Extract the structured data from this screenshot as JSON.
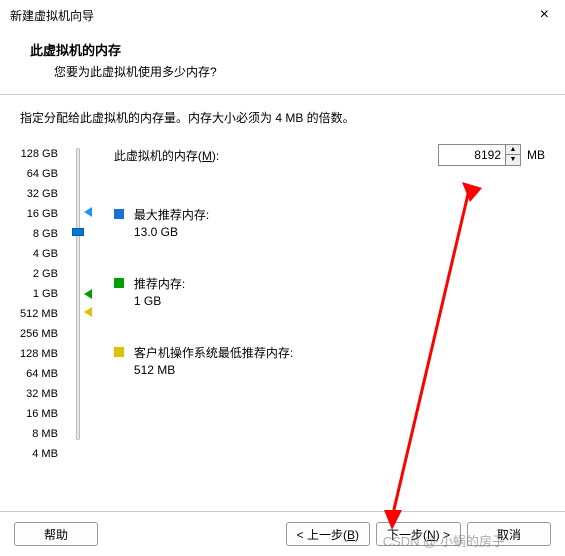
{
  "titlebar": {
    "title": "新建虚拟机向导",
    "close": "×"
  },
  "header": {
    "title": "此虚拟机的内存",
    "subtitle": "您要为此虚拟机使用多少内存?"
  },
  "instruction": "指定分配给此虚拟机的内存量。内存大小必须为 4 MB 的倍数。",
  "memory": {
    "label_pre": "此虚拟机的内存(",
    "label_key": "M",
    "label_post": "):",
    "value": "8192",
    "unit": "MB"
  },
  "scale": [
    "128 GB",
    "64 GB",
    "32 GB",
    "16 GB",
    "8 GB",
    "4 GB",
    "2 GB",
    "1 GB",
    "512 MB",
    "256 MB",
    "128 MB",
    "64 MB",
    "32 MB",
    "16 MB",
    "8 MB",
    "4 MB"
  ],
  "recommendations": {
    "max": {
      "label": "最大推荐内存:",
      "value": "13.0 GB"
    },
    "rec": {
      "label": "推荐内存:",
      "value": "1 GB"
    },
    "min": {
      "label": "客户机操作系统最低推荐内存:",
      "value": "512 MB"
    }
  },
  "buttons": {
    "help": "帮助",
    "back_pre": "< 上一步(",
    "back_key": "B",
    "back_post": ")",
    "next_pre": "下一步(",
    "next_key": "N",
    "next_post": ") >",
    "cancel": "取消"
  },
  "watermark": "CSDN @ 小蜗的房子"
}
